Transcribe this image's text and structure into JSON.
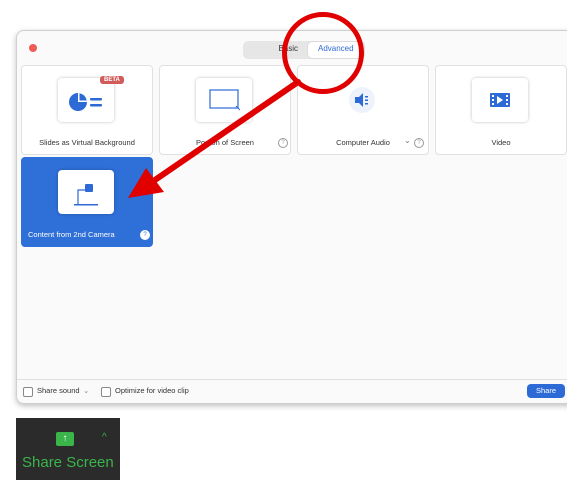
{
  "tabs": {
    "basic": "Basic",
    "advanced": "Advanced"
  },
  "tiles": [
    {
      "label": "Slides as Virtual Background",
      "badge": "BETA"
    },
    {
      "label": "Portion of Screen",
      "help": "?"
    },
    {
      "label": "Computer Audio",
      "help": "?",
      "dropdown": "⌄"
    },
    {
      "label": "Video"
    },
    {
      "label": "Content from 2nd Camera",
      "help": "?"
    }
  ],
  "bottom": {
    "share_sound": "Share sound",
    "share_sound_caret": "⌄",
    "optimize": "Optimize for video clip",
    "share_button": "Share"
  },
  "share_screen": {
    "label": "Share Screen",
    "up": "↑",
    "caret": "^"
  },
  "colors": {
    "accent_blue": "#2f6fd8",
    "annotation_red": "#e00000",
    "zoom_green": "#3ab54a"
  }
}
